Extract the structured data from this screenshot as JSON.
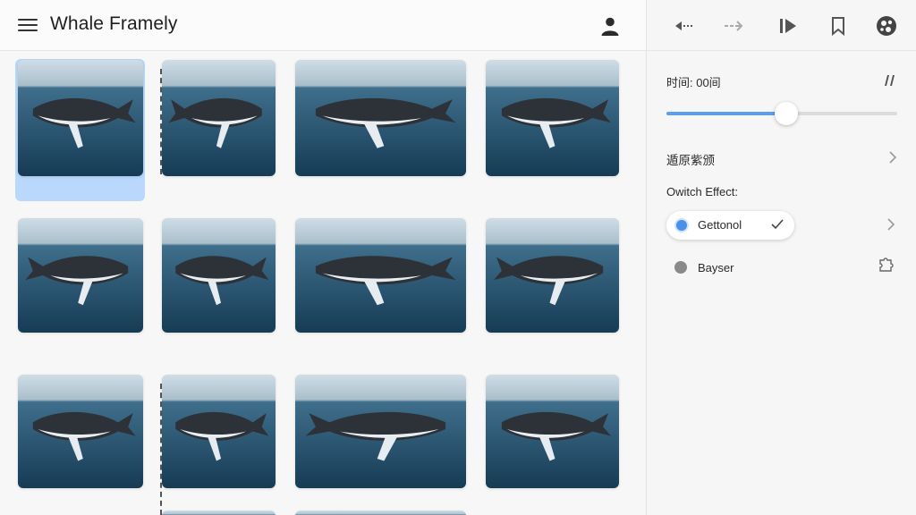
{
  "header": {
    "app_title": "Whale Framely",
    "menu_icon": "hamburger-menu-icon",
    "account_icon": "account-icon"
  },
  "toolbar": {
    "icons": [
      "rewind-icon",
      "forward-arrow-icon",
      "play-next-icon",
      "bookmark-icon",
      "globe-icon"
    ]
  },
  "panel": {
    "time_label": "时间: 00间",
    "pause_icon": "pause-icon",
    "slider_value": 0.52,
    "row_link_label": "遁原紫颁",
    "effect_heading": "Owitch Effect:",
    "options": [
      {
        "label": "Gettonol",
        "selected": true
      },
      {
        "label": "Bayser",
        "selected": false
      }
    ]
  },
  "gallery": {
    "selected_index": 0,
    "thumbnail_count": 12
  },
  "colors": {
    "accent": "#4a8fe8",
    "selection_bg": "#b9d8fb",
    "slider_fill": "#5a9ef0"
  }
}
